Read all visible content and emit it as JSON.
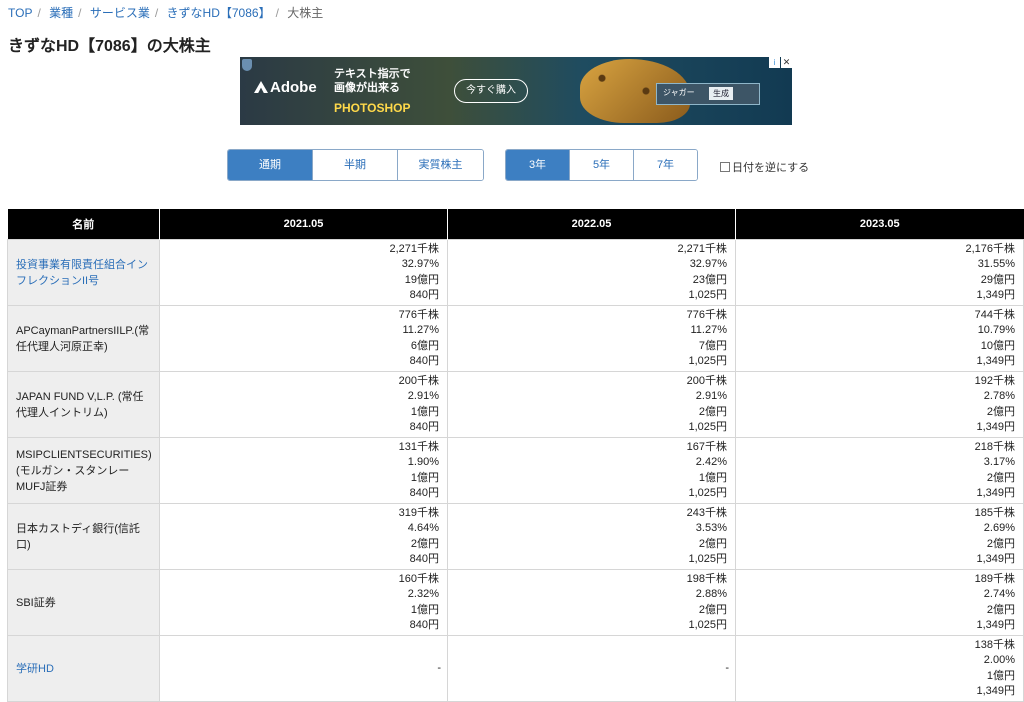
{
  "breadcrumb": [
    "TOP",
    "業種",
    "サービス業",
    "きずなHD【7086】",
    "大株主"
  ],
  "page_title": "きずなHD【7086】の大株主",
  "ad": {
    "brand": "Adobe",
    "copy_line1": "テキスト指示で",
    "copy_line2": "画像が出来る",
    "product": "PHOTOSHOP",
    "cta": "今すぐ購入",
    "tag1": "ジャガー",
    "tag2": "生成"
  },
  "period_tabs": [
    "通期",
    "半期",
    "実質株主"
  ],
  "year_tabs": [
    "3年",
    "5年",
    "7年"
  ],
  "reverse_label": "日付を逆にする",
  "table": {
    "headers": [
      "名前",
      "2021.05",
      "2022.05",
      "2023.05"
    ],
    "rows": [
      {
        "name": "投資事業有限責任組合インフレクションII号",
        "link": true,
        "cells": [
          [
            "2,271千株",
            "32.97%",
            "19億円",
            "840円"
          ],
          [
            "2,271千株",
            "32.97%",
            "23億円",
            "1,025円"
          ],
          [
            "2,176千株",
            "31.55%",
            "29億円",
            "1,349円"
          ]
        ]
      },
      {
        "name": "APCaymanPartnersIILP.(常任代理人河原正幸)",
        "link": false,
        "cells": [
          [
            "776千株",
            "11.27%",
            "6億円",
            "840円"
          ],
          [
            "776千株",
            "11.27%",
            "7億円",
            "1,025円"
          ],
          [
            "744千株",
            "10.79%",
            "10億円",
            "1,349円"
          ]
        ]
      },
      {
        "name": "JAPAN FUND V,L.P. (常任代理人イントリム)",
        "link": false,
        "cells": [
          [
            "200千株",
            "2.91%",
            "1億円",
            "840円"
          ],
          [
            "200千株",
            "2.91%",
            "2億円",
            "1,025円"
          ],
          [
            "192千株",
            "2.78%",
            "2億円",
            "1,349円"
          ]
        ]
      },
      {
        "name": "MSIPCLIENTSECURITIES)(モルガン・スタンレーMUFJ証券",
        "link": false,
        "cells": [
          [
            "131千株",
            "1.90%",
            "1億円",
            "840円"
          ],
          [
            "167千株",
            "2.42%",
            "1億円",
            "1,025円"
          ],
          [
            "218千株",
            "3.17%",
            "2億円",
            "1,349円"
          ]
        ]
      },
      {
        "name": "日本カストディ銀行(信託口)",
        "link": false,
        "cells": [
          [
            "319千株",
            "4.64%",
            "2億円",
            "840円"
          ],
          [
            "243千株",
            "3.53%",
            "2億円",
            "1,025円"
          ],
          [
            "185千株",
            "2.69%",
            "2億円",
            "1,349円"
          ]
        ]
      },
      {
        "name": "SBI証券",
        "link": false,
        "cells": [
          [
            "160千株",
            "2.32%",
            "1億円",
            "840円"
          ],
          [
            "198千株",
            "2.88%",
            "2億円",
            "1,025円"
          ],
          [
            "189千株",
            "2.74%",
            "2億円",
            "1,349円"
          ]
        ]
      },
      {
        "name": "学研HD",
        "link": true,
        "cells": [
          [
            "-"
          ],
          [
            "-"
          ],
          [
            "138千株",
            "2.00%",
            "1億円",
            "1,349円"
          ]
        ]
      }
    ]
  }
}
